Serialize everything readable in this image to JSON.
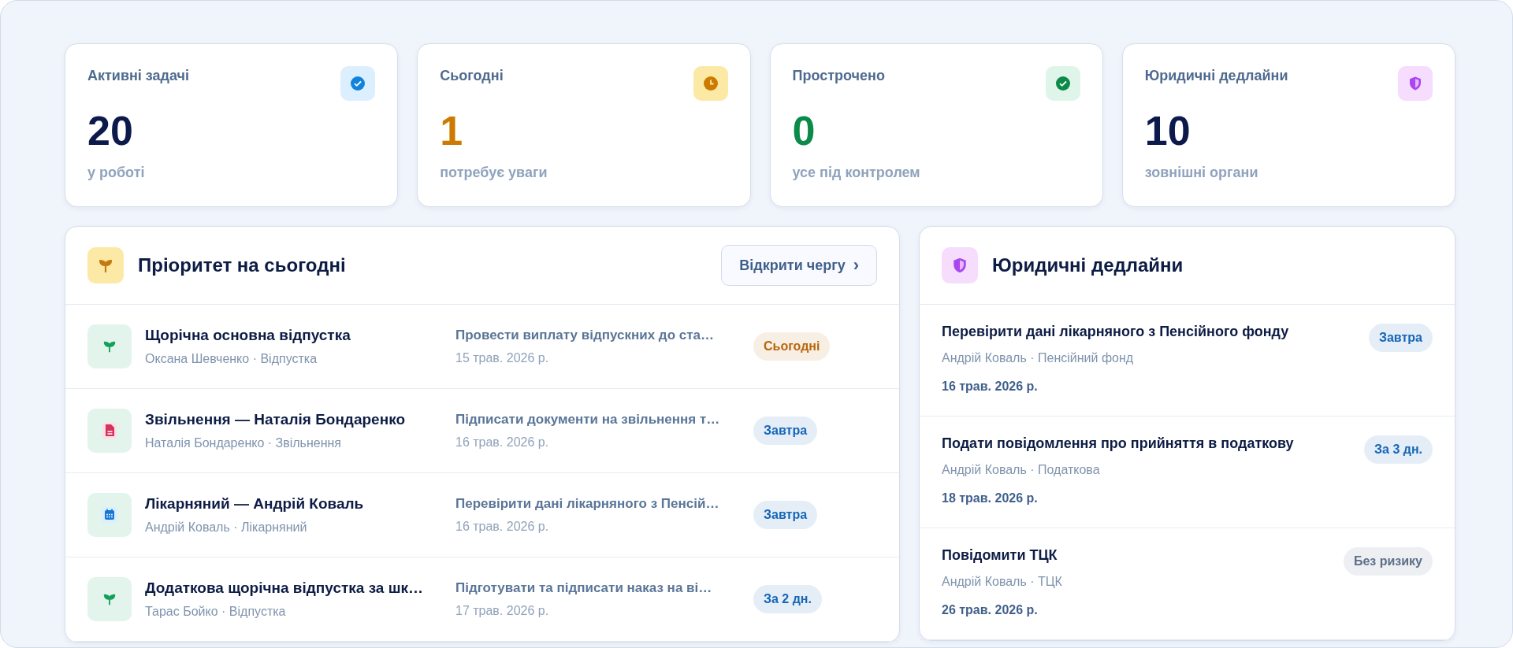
{
  "stats": [
    {
      "label": "Активні задачі",
      "value": "20",
      "caption": "у роботі",
      "color": "#0b1a4a"
    },
    {
      "label": "Сьогодні",
      "value": "1",
      "caption": "потребує уваги",
      "color": "#cc7a00"
    },
    {
      "label": "Прострочено",
      "value": "0",
      "caption": "усе під контролем",
      "color": "#0c8a4a"
    },
    {
      "label": "Юридичні дедлайни",
      "value": "10",
      "caption": "зовнішні органи",
      "color": "#0b1a4a"
    }
  ],
  "priority": {
    "title": "Пріоритет на сьогодні",
    "button": "Відкрити чергу",
    "button_icon": "›",
    "items": [
      {
        "kind": "leave",
        "title": "Щорічна основна відпустка",
        "meta": "Оксана Шевченко · Відпустка",
        "task": "Провести виплату відпускних до ста…",
        "date": "15 трав. 2026 р.",
        "badge": "Сьогодні",
        "color": "#b9650a"
      },
      {
        "kind": "dismissal",
        "title": "Звільнення — Наталія Бондаренко",
        "meta": "Наталія Бондаренко · Звільнення",
        "task": "Підписати документи на звільнення т…",
        "date": "16 трав. 2026 р.",
        "badge": "Завтра",
        "color": "#1566b8"
      },
      {
        "kind": "sick",
        "title": "Лікарняний — Андрій Коваль",
        "meta": "Андрій Коваль · Лікарняний",
        "task": "Перевірити дані лікарняного з Пенсій…",
        "date": "16 трав. 2026 р.",
        "badge": "Завтра",
        "color": "#1566b8"
      },
      {
        "kind": "leave",
        "title": "Додаткова щорічна відпустка за шк…",
        "meta": "Тарас Бойко · Відпустка",
        "task": "Підготувати та підписати наказ на ві…",
        "date": "17 трав. 2026 р.",
        "badge": "За 2 дн.",
        "color": "#1566b8"
      }
    ]
  },
  "legal": {
    "title": "Юридичні дедлайни",
    "items": [
      {
        "title": "Перевірити дані лікарняного з Пенсійного фонду",
        "meta": "Андрій Коваль · Пенсійний фонд",
        "date": "16 трав. 2026 р.",
        "badge": "Завтра",
        "color": "#1566b8"
      },
      {
        "title": "Подати повідомлення про прийняття в податкову",
        "meta": "Андрій Коваль · Податкова",
        "date": "18 трав. 2026 р.",
        "badge": "За 3 дн.",
        "color": "#1566b8"
      },
      {
        "title": "Повідомити ТЦК",
        "meta": "Андрій Коваль · ТЦК",
        "date": "26 трав. 2026 р.",
        "badge": "Без ризику",
        "color": "#5c6f89"
      }
    ]
  }
}
